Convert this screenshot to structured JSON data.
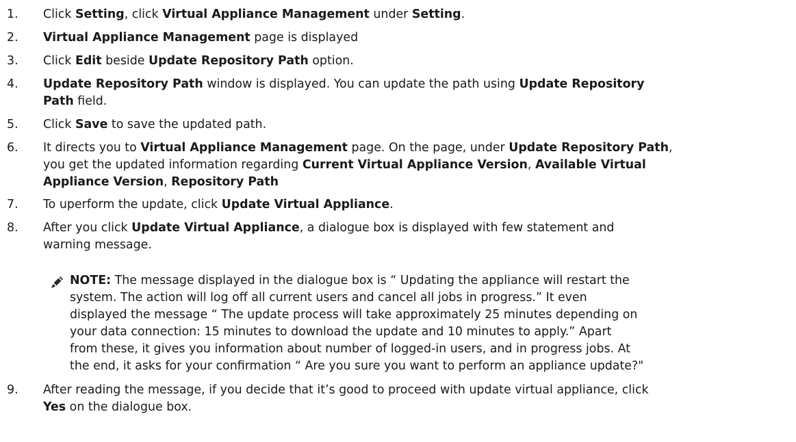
{
  "steps": [
    {
      "num": "1.",
      "parts": [
        {
          "t": "Click "
        },
        {
          "t": "Setting",
          "b": true
        },
        {
          "t": ", click "
        },
        {
          "t": "Virtual Appliance Management",
          "b": true
        },
        {
          "t": " under "
        },
        {
          "t": "Setting",
          "b": true
        },
        {
          "t": "."
        }
      ]
    },
    {
      "num": "2.",
      "parts": [
        {
          "t": "Virtual Appliance Management",
          "b": true
        },
        {
          "t": " page is displayed"
        }
      ]
    },
    {
      "num": "3.",
      "parts": [
        {
          "t": "Click "
        },
        {
          "t": "Edit",
          "b": true
        },
        {
          "t": " beside "
        },
        {
          "t": "Update Repository Path",
          "b": true
        },
        {
          "t": " option."
        }
      ]
    },
    {
      "num": "4.",
      "parts": [
        {
          "t": "Update Repository Path",
          "b": true
        },
        {
          "t": " window is displayed. You can update the path using "
        },
        {
          "t": "Update Repository",
          "b": true
        },
        {
          "br": true
        },
        {
          "t": "Path",
          "b": true
        },
        {
          "t": " field."
        }
      ]
    },
    {
      "num": "5.",
      "parts": [
        {
          "t": "Click "
        },
        {
          "t": "Save",
          "b": true
        },
        {
          "t": " to save the updated path."
        }
      ]
    },
    {
      "num": "6.",
      "parts": [
        {
          "t": "It directs you to "
        },
        {
          "t": "Virtual Appliance Management",
          "b": true
        },
        {
          "t": " page. On the page, under "
        },
        {
          "t": "Update Repository Path",
          "b": true
        },
        {
          "t": ","
        },
        {
          "br": true
        },
        {
          "t": "you get the updated information regarding "
        },
        {
          "t": "Current Virtual Appliance Version",
          "b": true
        },
        {
          "t": ", "
        },
        {
          "t": "Available Virtual",
          "b": true
        },
        {
          "br": true
        },
        {
          "t": "Appliance Version",
          "b": true
        },
        {
          "t": ", "
        },
        {
          "t": "Repository Path",
          "b": true
        }
      ]
    },
    {
      "num": "7.",
      "parts": [
        {
          "t": "To uperform the update, click "
        },
        {
          "t": "Update Virtual Appliance",
          "b": true
        },
        {
          "t": "."
        }
      ]
    },
    {
      "num": "8.",
      "parts": [
        {
          "t": "After you click "
        },
        {
          "t": "Update Virtual Appliance",
          "b": true
        },
        {
          "t": ", a dialogue box is displayed with few statement and"
        },
        {
          "br": true
        },
        {
          "t": "warning message."
        }
      ]
    },
    {
      "num": "9.",
      "parts": [
        {
          "t": "After reading the message, if you decide that it’s good to proceed with update virtual appliance, click"
        },
        {
          "br": true
        },
        {
          "t": "Yes",
          "b": true
        },
        {
          "t": " on the dialogue box."
        }
      ]
    }
  ],
  "note": {
    "icon": "pencil-note-icon",
    "parts": [
      {
        "t": "NOTE:",
        "b": true
      },
      {
        "t": " The message displayed in the dialogue box is “ Updating the appliance will restart the"
      },
      {
        "br": true
      },
      {
        "t": "system. The action will log off all current users and cancel all jobs in progress.” It even"
      },
      {
        "br": true
      },
      {
        "t": "displayed the message “ The update process will take approximately 25 minutes depending on"
      },
      {
        "br": true
      },
      {
        "t": "your data connection: 15 minutes to download the update and 10 minutes to apply.” Apart"
      },
      {
        "br": true
      },
      {
        "t": "from these, it gives you information about number of logged-in users, and in progress jobs. At"
      },
      {
        "br": true
      },
      {
        "t": "the end, it asks for your confirmation “ Are you sure you want to perform an appliance update?\""
      }
    ]
  }
}
